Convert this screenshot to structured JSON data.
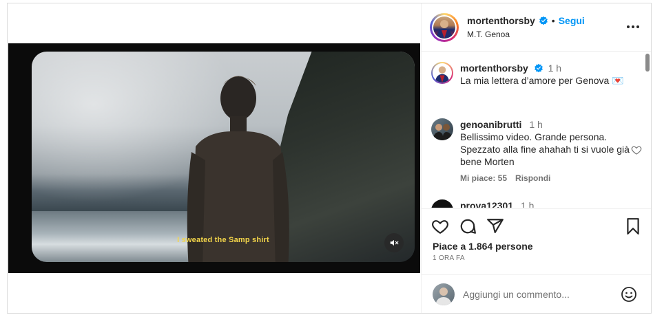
{
  "post": {
    "author": "mortenthorsby",
    "follow_label": "Segui",
    "separator": "•",
    "location": "M.T. Genoa",
    "video_subtitle": "I sweated the Samp shirt"
  },
  "caption": {
    "username": "mortenthorsby",
    "time": "1 h",
    "text": "La mia lettera d’amore per Genova 💌"
  },
  "comments": [
    {
      "username": "genoanibrutti",
      "time": "1 h",
      "text": "Bellissimo video. Grande persona. Spezzato alla fine ahahah ti si vuole già bene Morten",
      "likes_label": "Mi piace: 55",
      "reply_label": "Rispondi"
    },
    {
      "username": "prova12301",
      "time": "1 h"
    }
  ],
  "actions": {
    "likes_text": "Piace a 1.864 persone",
    "time_ago": "1 ORA FA"
  },
  "add_comment": {
    "placeholder": "Aggiungi un commento..."
  },
  "colors": {
    "accent": "#0095f6",
    "subtitle": "#f3d54a",
    "text": "#262626",
    "muted": "#737373"
  },
  "icons": [
    "verified-badge-icon",
    "more-options-icon",
    "mute-icon",
    "heart-icon",
    "comment-icon",
    "share-icon",
    "bookmark-icon",
    "emoji-icon"
  ]
}
